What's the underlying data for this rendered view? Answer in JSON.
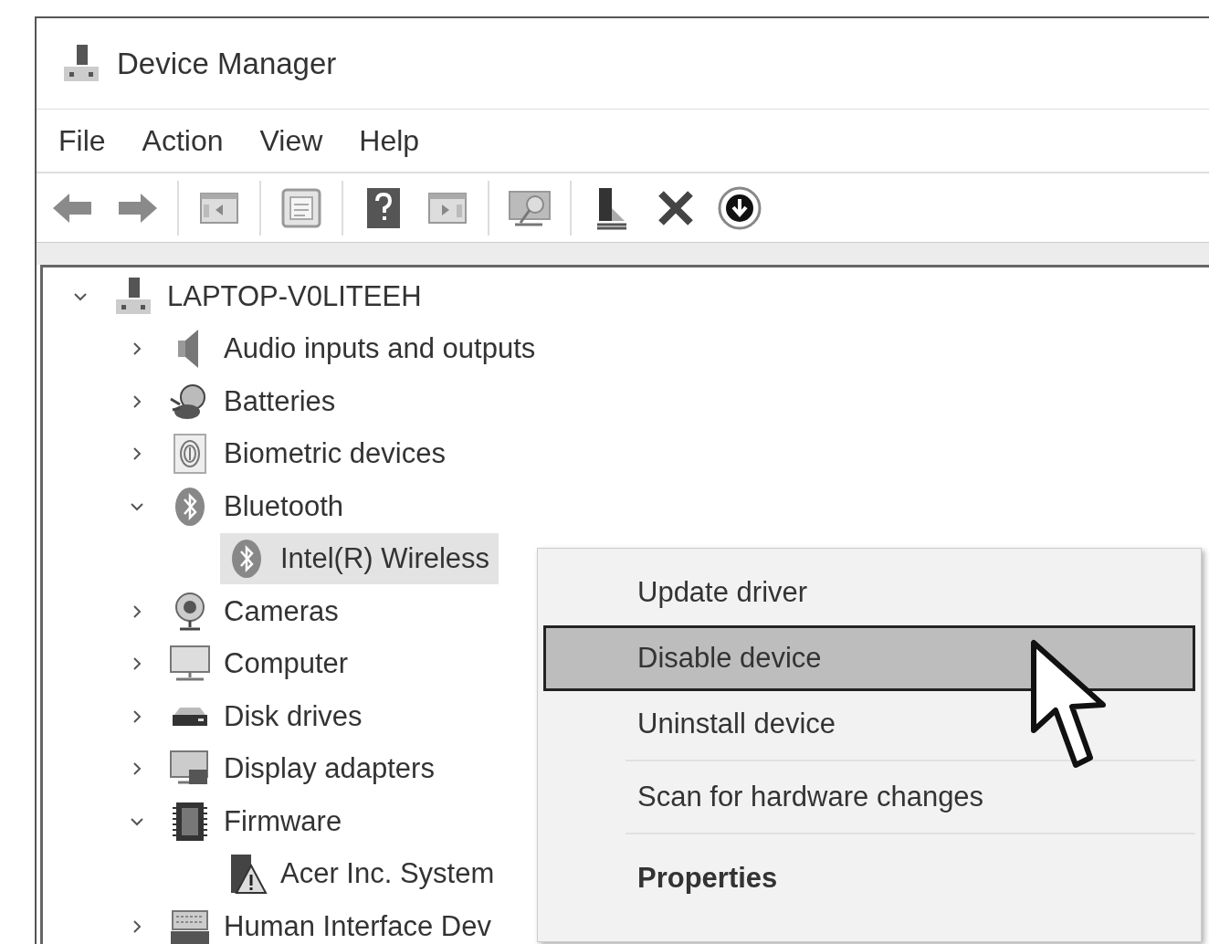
{
  "window": {
    "title": "Device Manager"
  },
  "menu": [
    "File",
    "Action",
    "View",
    "Help"
  ],
  "toolbar": [
    {
      "kind": "back"
    },
    {
      "kind": "forward"
    },
    {
      "kind": "separator"
    },
    {
      "kind": "show-hide"
    },
    {
      "kind": "separator"
    },
    {
      "kind": "properties"
    },
    {
      "kind": "separator"
    },
    {
      "kind": "help"
    },
    {
      "kind": "action-pane"
    },
    {
      "kind": "separator"
    },
    {
      "kind": "scan"
    },
    {
      "kind": "separator"
    },
    {
      "kind": "update-driver"
    },
    {
      "kind": "uninstall"
    },
    {
      "kind": "download"
    }
  ],
  "tree": {
    "label": "LAPTOP-V0LITEEH",
    "kind": "computer",
    "expanded": true,
    "selected": false,
    "children": [
      {
        "label": "Audio inputs and outputs",
        "kind": "audio",
        "expanded": false,
        "selected": false
      },
      {
        "label": "Batteries",
        "kind": "battery",
        "expanded": false,
        "selected": false
      },
      {
        "label": "Biometric devices",
        "kind": "fingerprint",
        "expanded": false,
        "selected": false
      },
      {
        "label": "Bluetooth",
        "kind": "bluetooth",
        "expanded": true,
        "selected": false,
        "children": [
          {
            "label": "Intel(R) Wireless",
            "kind": "bluetooth",
            "selected": true
          }
        ]
      },
      {
        "label": "Cameras",
        "kind": "camera",
        "expanded": false,
        "selected": false
      },
      {
        "label": "Computer",
        "kind": "monitor",
        "expanded": false,
        "selected": false
      },
      {
        "label": "Disk drives",
        "kind": "disk",
        "expanded": false,
        "selected": false
      },
      {
        "label": "Display adapters",
        "kind": "display-adapter",
        "expanded": false,
        "selected": false
      },
      {
        "label": "Firmware",
        "kind": "chip",
        "expanded": true,
        "selected": false,
        "children": [
          {
            "label": "Acer Inc. System",
            "kind": "chip-warning",
            "selected": false
          }
        ]
      },
      {
        "label": "Human Interface Dev",
        "kind": "keyboard",
        "expanded": false,
        "selected": false
      }
    ]
  },
  "context_menu": {
    "items": [
      {
        "kind": "item",
        "label": "Update driver",
        "selected": false
      },
      {
        "kind": "item",
        "label": "Disable device",
        "selected": true
      },
      {
        "kind": "item",
        "label": "Uninstall device",
        "selected": false
      },
      {
        "kind": "separator"
      },
      {
        "kind": "item",
        "label": "Scan for hardware changes",
        "selected": false
      },
      {
        "kind": "separator"
      },
      {
        "kind": "default",
        "label": "Properties",
        "selected": false
      }
    ]
  }
}
